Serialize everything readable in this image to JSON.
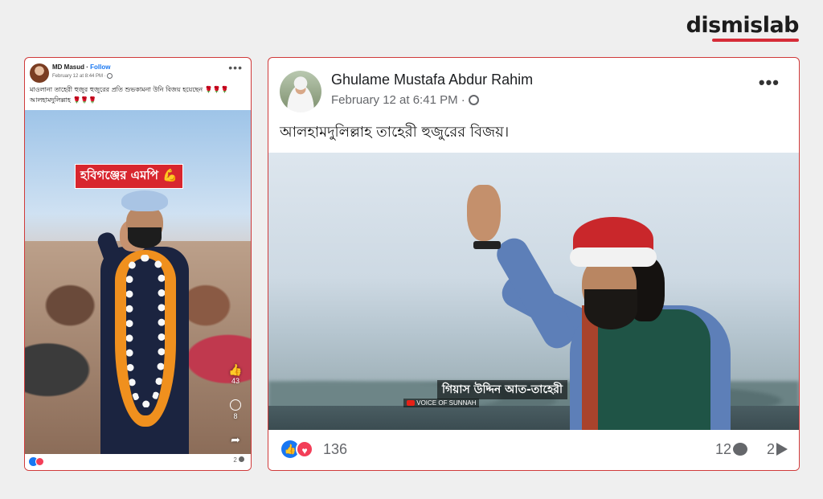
{
  "brand": {
    "name": "dismislab",
    "accent": "#d62c38"
  },
  "post_small": {
    "author": "MD Masud",
    "follow_label": "Follow",
    "separator": " · ",
    "meta": "February 12 at 8:44 PM · ",
    "more_icon": "more-dots-icon",
    "text": "মাওলানা তাহেরী হুজুর হুজুরের প্রতি শুভকামনা উনি বিজয় হয়েছেন 🌹🌹🌹 আলহামদুলিল্লাহ 🌹🌹🌹",
    "photo_banner": "হবিগঞ্জের এমপি 💪",
    "side_likes": "43",
    "side_comments": "8",
    "footer_comments": "2"
  },
  "post_big": {
    "author": "Ghulame Mustafa Abdur Rahim",
    "meta": "February 12 at 6:41 PM · ",
    "more_icon": "more-dots-icon",
    "text": "আলহামদুলিল্লাহ তাহেরী হুজুরের বিজয়।",
    "photo_caption": "গিয়াস উদ্দিন আত-তাহেরী",
    "photo_subcaption": "VOICE OF SUNNAH",
    "reactions_count": "136",
    "comments_count": "12",
    "shares_count": "2"
  }
}
